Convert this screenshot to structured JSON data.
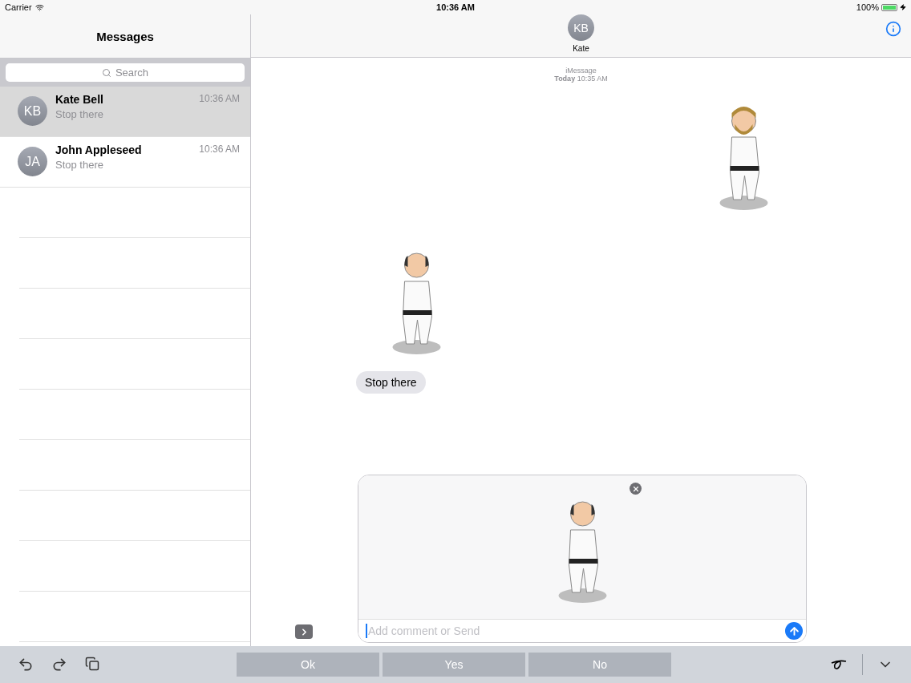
{
  "status_bar": {
    "carrier": "Carrier",
    "time": "10:36 AM",
    "battery": "100%"
  },
  "sidebar": {
    "title": "Messages",
    "search": {
      "placeholder": "Search"
    },
    "conversations": [
      {
        "initials": "KB",
        "name": "Kate Bell",
        "time": "10:36 AM",
        "preview": "Stop there",
        "selected": true
      },
      {
        "initials": "JA",
        "name": "John Appleseed",
        "time": "10:36 AM",
        "preview": "Stop there",
        "selected": false
      }
    ]
  },
  "chat": {
    "contact": {
      "initials": "KB",
      "name": "Kate"
    },
    "meta": {
      "service": "iMessage",
      "day": "Today",
      "time": "10:35 AM"
    },
    "messages": [
      {
        "kind": "sent_sticker"
      },
      {
        "kind": "received_sticker"
      },
      {
        "kind": "received_text",
        "text": "Stop there"
      }
    ],
    "composer": {
      "placeholder": "Add comment or Send"
    }
  },
  "keyboard_bar": {
    "quick_replies": [
      "Ok",
      "Yes",
      "No"
    ]
  }
}
